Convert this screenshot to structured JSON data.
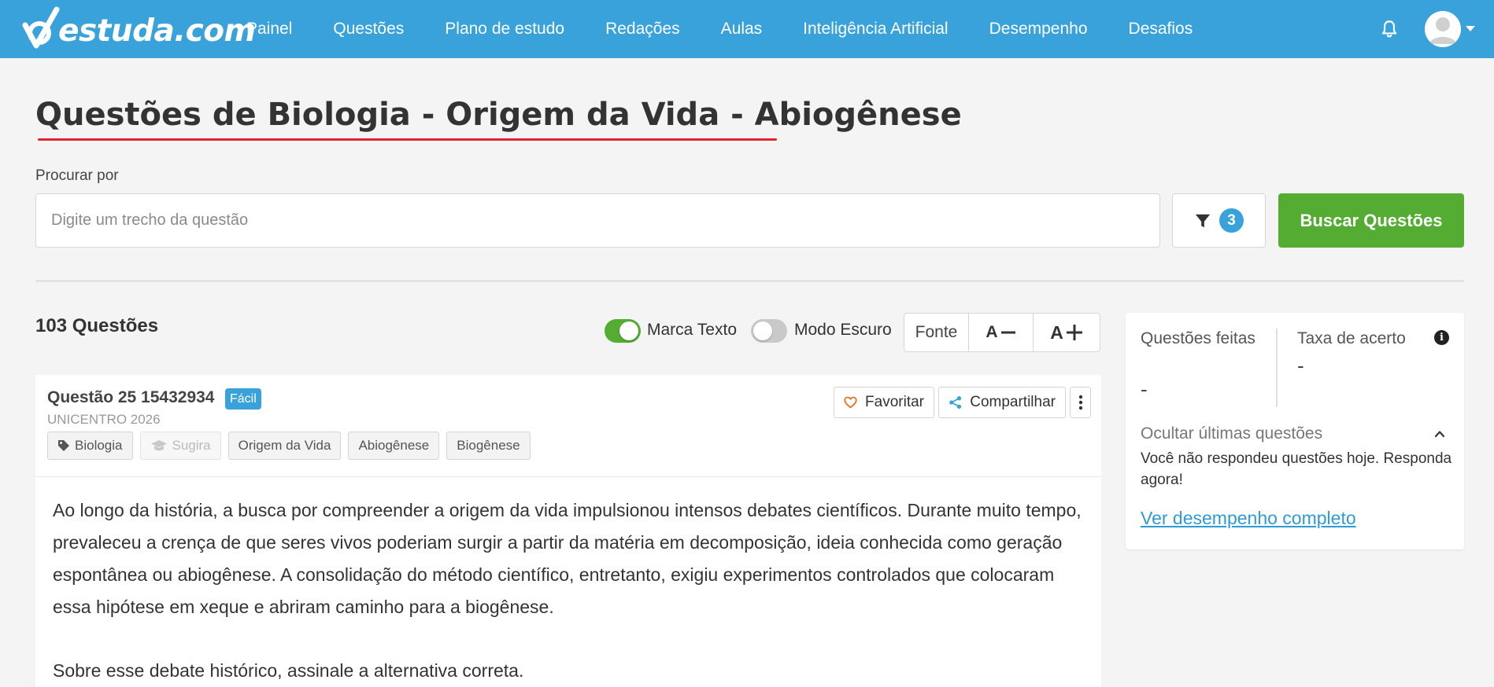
{
  "brand": {
    "logo_text": "estuda.com"
  },
  "nav": {
    "items": [
      {
        "label": "Painel"
      },
      {
        "label": "Questões"
      },
      {
        "label": "Plano de estudo"
      },
      {
        "label": "Redações"
      },
      {
        "label": "Aulas"
      },
      {
        "label": "Inteligência Artificial"
      },
      {
        "label": "Desempenho"
      },
      {
        "label": "Desafios"
      }
    ]
  },
  "header": {
    "bell_icon": "bell-icon",
    "avatar_icon": "user-avatar-icon"
  },
  "page": {
    "title": "Questões de Biologia - Origem da Vida - Abiogênese"
  },
  "search": {
    "label": "Procurar por",
    "placeholder": "Digite um trecho da questão",
    "value": "",
    "filter_count": "3",
    "submit_label": "Buscar Questões"
  },
  "toolbar": {
    "count": "103 Questões",
    "marca_texto": {
      "label": "Marca Texto",
      "on": true
    },
    "modo_escuro": {
      "label": "Modo Escuro",
      "on": false
    },
    "font_label": "Fonte",
    "font_decrease": "A",
    "font_increase": "A"
  },
  "question": {
    "title": "Questão 25 15432934",
    "difficulty": "Fácil",
    "source": "UNICENTRO 2026",
    "tags": [
      {
        "label": "Biologia",
        "icon": "tag-icon"
      },
      {
        "label": "Sugira",
        "icon": "graduation-cap-icon",
        "muted": true
      },
      {
        "label": "Origem da Vida"
      },
      {
        "label": "Abiogênese"
      },
      {
        "label": "Biogênese"
      }
    ],
    "actions": {
      "favorite": "Favoritar",
      "share": "Compartilhar"
    },
    "body": "Ao longo da história, a busca por compreender a origem da vida impulsionou intensos debates científicos. Durante muito tempo, prevaleceu a crença de que seres vivos poderiam surgir a partir da matéria em decomposição, ideia conhecida como geração espontânea ou abiogênese. A consolidação do método científico, entretanto, exigiu experimentos controlados que colocaram essa hipótese em xeque e abriram caminho para a biogênese.",
    "prompt": "Sobre esse debate histórico, assinale a alternativa correta."
  },
  "side": {
    "done_label": "Questões feitas",
    "done_value": "-",
    "rate_label": "Taxa de acerto",
    "rate_value": "-",
    "hide_label": "Ocultar últimas questões",
    "no_answers": "Você não respondeu questões hoje. Responda agora!",
    "performance_link": "Ver desempenho completo"
  },
  "colors": {
    "primary": "#39a2db",
    "success": "#54ad32",
    "underline": "#e3242b",
    "warning": "#e8772e"
  }
}
